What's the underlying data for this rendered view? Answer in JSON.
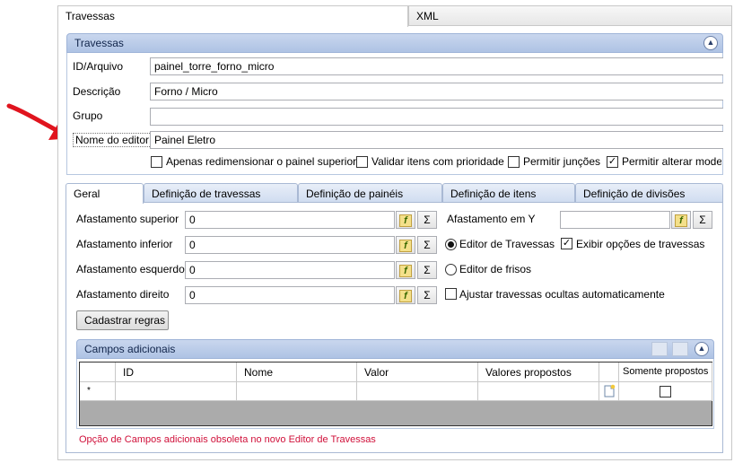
{
  "top_tabs": [
    "Travessas",
    "XML"
  ],
  "travessas_group": {
    "title": "Travessas",
    "fields": [
      {
        "label": "ID/Arquivo",
        "value": "painel_torre_forno_micro"
      },
      {
        "label": "Descrição",
        "value": "Forno / Micro"
      },
      {
        "label": "Grupo",
        "value": ""
      },
      {
        "label": "Nome do editor",
        "value": "Painel Eletro"
      }
    ],
    "options": [
      {
        "label": "Apenas redimensionar o painel superior",
        "checked": false
      },
      {
        "label": "Validar itens com prioridade",
        "checked": false
      },
      {
        "label": "Permitir junções",
        "checked": false
      },
      {
        "label": "Permitir alterar modelo",
        "checked": true
      }
    ]
  },
  "sub_tabs": [
    "Geral",
    "Definição de travessas",
    "Definição de painéis",
    "Definição de itens",
    "Definição de divisões"
  ],
  "geral": {
    "left_fields": [
      {
        "label": "Afastamento superior",
        "value": "0"
      },
      {
        "label": "Afastamento inferior",
        "value": "0"
      },
      {
        "label": "Afastamento esquerdo",
        "value": "0"
      },
      {
        "label": "Afastamento direito",
        "value": "0"
      }
    ],
    "afastamento_y": {
      "label": "Afastamento em Y",
      "value": ""
    },
    "editor_travessas": "Editor de Travessas",
    "editor_frisos": "Editor de frisos",
    "exibir_opcoes": "Exibir opções de travessas",
    "ajustar_ocultas": "Ajustar travessas ocultas automaticamente",
    "cadastrar_regras": "Cadastrar regras",
    "fx_icon": "formula-icon",
    "sigma_symbol": "Σ"
  },
  "campos_adicionais": {
    "title": "Campos adicionais",
    "columns": [
      "ID",
      "Nome",
      "Valor",
      "Valores propostos",
      "Somente propostos"
    ],
    "new_row_marker": "*",
    "warning": "Opção de Campos adicionais obsoleta no novo Editor de Travessas"
  },
  "colors": {
    "arrow": "#e0141e",
    "warning": "#d0103a",
    "header_blue": "#aec3e4"
  }
}
